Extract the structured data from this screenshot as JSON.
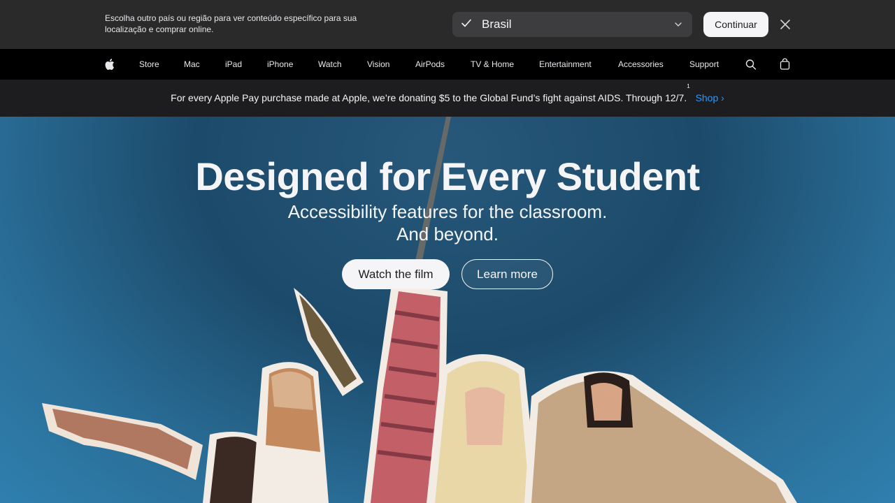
{
  "locale_bar": {
    "message": "Escolha outro país ou região para ver conteúdo específico para sua localização e comprar online.",
    "selected_region": "Brasil",
    "continue_label": "Continuar",
    "close_icon": "close-icon",
    "check_icon": "checkmark-icon"
  },
  "nav": {
    "logo_icon": "apple-logo-icon",
    "items": [
      "Store",
      "Mac",
      "iPad",
      "iPhone",
      "Watch",
      "Vision",
      "AirPods",
      "TV & Home",
      "Entertainment",
      "Accessories",
      "Support"
    ],
    "search_icon": "search-icon",
    "bag_icon": "bag-icon"
  },
  "ribbon": {
    "text": "For every Apple Pay purchase made at Apple, we’re donating $5 to the Global Fund’s fight against AIDS. Through 12/7.",
    "footnote": "1",
    "link_label": "Shop",
    "link_chevron": "›"
  },
  "hero": {
    "title": "Designed for Every Student",
    "subtitle_line1": "Accessibility features for the classroom.",
    "subtitle_line2": "And beyond.",
    "primary_label": "Watch the film",
    "secondary_label": "Learn more"
  },
  "colors": {
    "locale_bg": "#2a2a2a",
    "nav_bg": "#000000",
    "ribbon_bg": "#1d1d1f",
    "link": "#2997ff",
    "hero_blue": "#2a6f99"
  }
}
